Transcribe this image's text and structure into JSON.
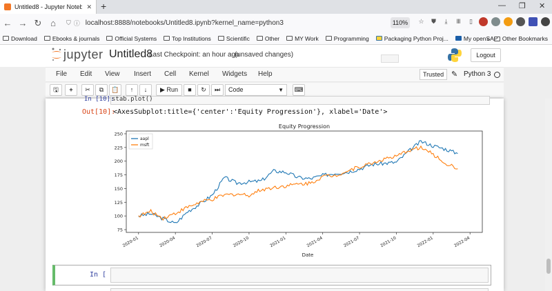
{
  "browser": {
    "tab_title": "Untitled8 - Jupyter Notebook",
    "url": "localhost:8888/notebooks/Untitled8.ipynb?kernel_name=python3",
    "zoom": "110%",
    "bookmarks": [
      "Download",
      "Ebooks & journals",
      "Official Systems",
      "Top Institutions",
      "Scientific",
      "Other",
      "MY Work",
      "Programming",
      "Packaging Python Proj...",
      "My openSAP"
    ],
    "other_bookmarks": "Other Bookmarks"
  },
  "jupyter": {
    "logo": "jupyter",
    "notebook_name": "Untitled8",
    "checkpoint": "Last Checkpoint: an hour ago",
    "unsaved": "(unsaved changes)",
    "logout": "Logout",
    "menu": [
      "File",
      "Edit",
      "View",
      "Insert",
      "Cell",
      "Kernel",
      "Widgets",
      "Help"
    ],
    "trusted": "Trusted",
    "kernel": "Python 3",
    "run_label": "Run",
    "cell_type": "Code"
  },
  "cells": {
    "prev_prompt": "In [10]:",
    "prev_code": "stab.plot()",
    "out_prompt": "Out[10]:",
    "out_text": "<AxesSubplot:title={'center':'Equity Progression'}, xlabel='Date'>",
    "in_prompt": "In [ ]:"
  },
  "chart_data": {
    "type": "line",
    "title": "Equity Progression",
    "xlabel": "Date",
    "ylabel": "",
    "x": [
      "2020-01",
      "2020-02",
      "2020-03",
      "2020-04",
      "2020-05",
      "2020-06",
      "2020-07",
      "2020-08",
      "2020-09",
      "2020-10",
      "2020-11",
      "2020-12",
      "2021-01",
      "2021-02",
      "2021-03",
      "2021-04",
      "2021-05",
      "2021-06",
      "2021-07",
      "2021-08",
      "2021-09",
      "2021-10",
      "2021-11",
      "2021-12",
      "2022-01",
      "2022-02",
      "2022-03"
    ],
    "x_ticks": [
      "2020-01",
      "2020-04",
      "2020-07",
      "2020-10",
      "2021-01",
      "2021-04",
      "2021-07",
      "2021-10",
      "2022-01",
      "2022-04"
    ],
    "y_ticks": [
      75,
      100,
      125,
      150,
      175,
      200,
      225,
      250
    ],
    "ylim": [
      70,
      255
    ],
    "legend_position": "upper-left",
    "series": [
      {
        "name": "aapl",
        "color": "#1f77b4",
        "values": [
          100,
          104,
          95,
          86,
          108,
          122,
          138,
          170,
          160,
          162,
          164,
          182,
          180,
          170,
          168,
          174,
          178,
          180,
          186,
          194,
          196,
          198,
          218,
          236,
          228,
          222,
          214
        ]
      },
      {
        "name": "msft",
        "color": "#ff7f0e",
        "values": [
          100,
          108,
          96,
          105,
          116,
          125,
          130,
          138,
          140,
          138,
          148,
          152,
          155,
          158,
          160,
          172,
          174,
          182,
          190,
          196,
          204,
          208,
          220,
          225,
          212,
          196,
          186
        ]
      }
    ]
  }
}
